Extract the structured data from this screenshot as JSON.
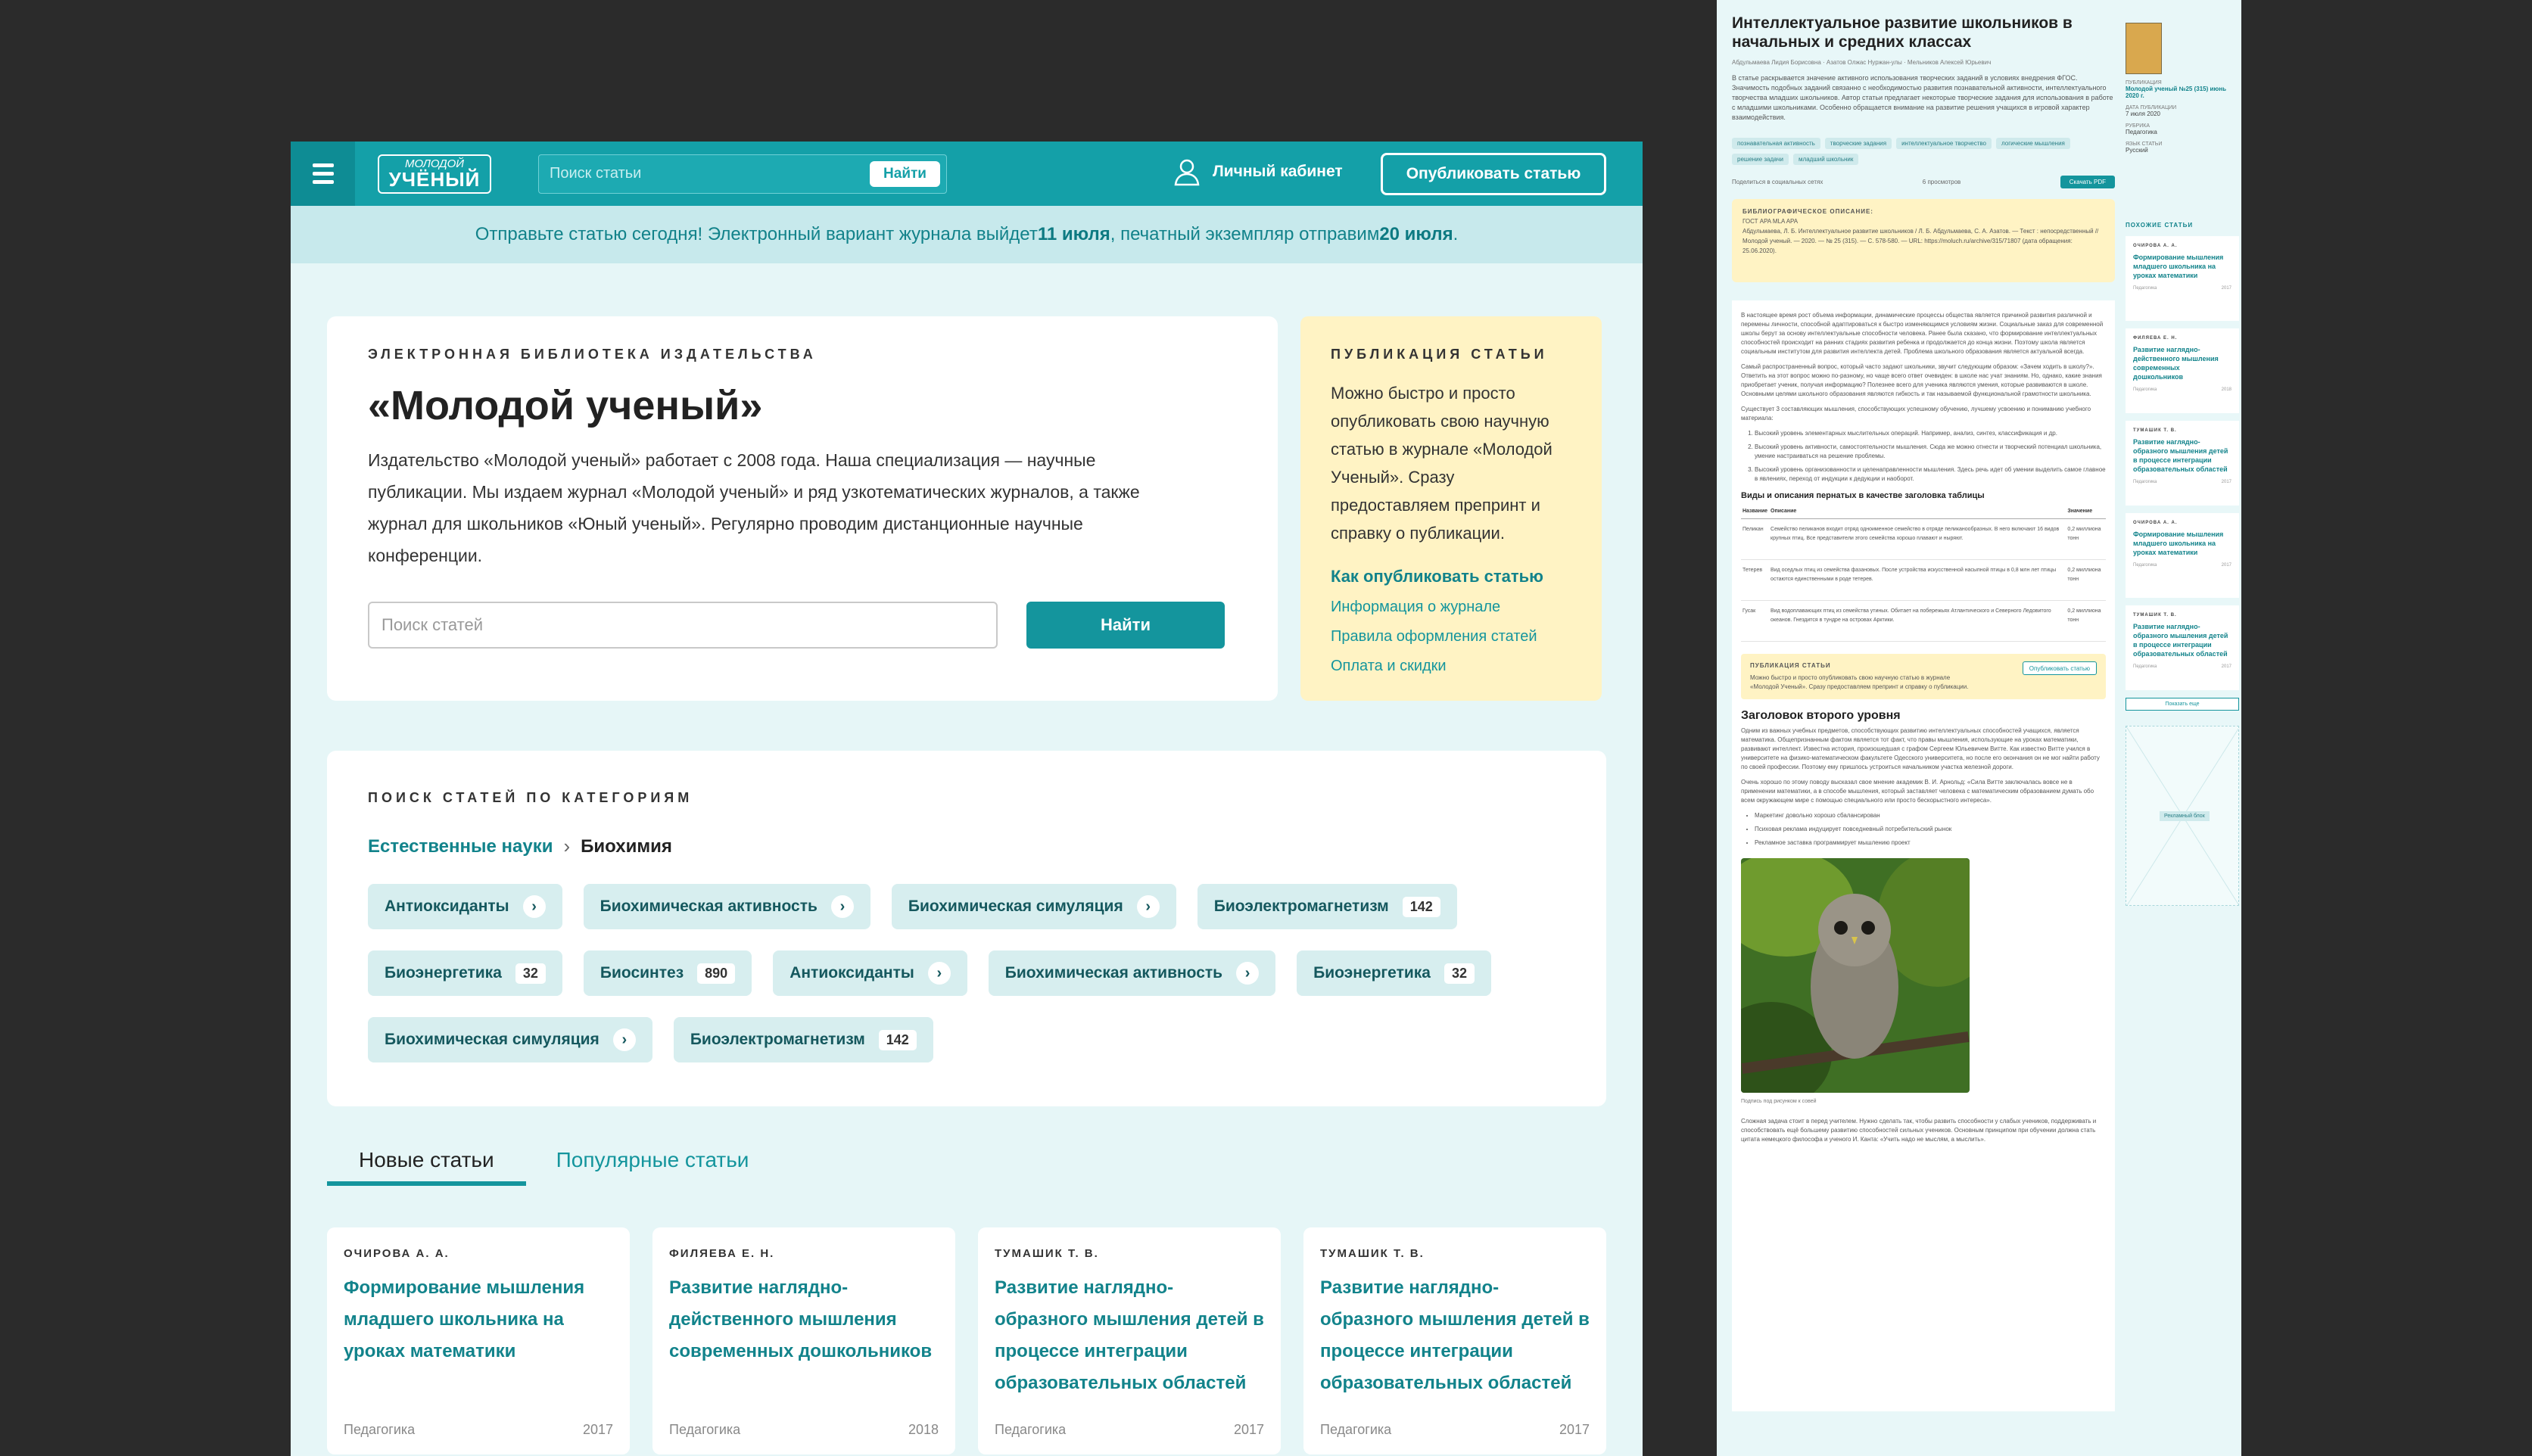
{
  "home": {
    "header": {
      "logo_line1": "МОЛОДОЙ",
      "logo_line2": "УЧЁНЫЙ",
      "search_placeholder": "Поиск статьи",
      "search_button": "Найти",
      "cabinet": "Личный кабинет",
      "publish_button": "Опубликовать статью"
    },
    "notice": {
      "part1": "Отправьте статью сегодня! Электронный вариант журнала выйдет ",
      "date1": "11 июля",
      "part2": ", печатный экземпляр отправим ",
      "date2": "20 июля",
      "part3": "."
    },
    "intro": {
      "kicker": "Электронная библиотека издательства",
      "title": "«Молодой ученый»",
      "text": "Издательство «Молодой ученый» работает с 2008 года. Наша специализация — научные публикации. Мы издаем журнал «Молодой ученый» и ряд узкотематических журналов, а также журнал для школьников «Юный ученый». Регулярно проводим дистанционные научные конференции.",
      "search_placeholder": "Поиск статей",
      "search_button": "Найти"
    },
    "publication": {
      "kicker": "Публикация статьи",
      "text": "Можно быстро и просто опубликовать свою научную статью в журнале «Молодой Ученый». Сразу предоставляем препринт и справку о публикации.",
      "how": "Как опубликовать статью",
      "links": [
        "Информация о журнале",
        "Правила оформления статей",
        "Оплата и скидки"
      ]
    },
    "categories": {
      "kicker": "Поиск статей по категориям",
      "crumb1": "Естественные науки",
      "crumb2": "Биохимия",
      "tags": [
        {
          "label": "Антиоксиданты",
          "count": null
        },
        {
          "label": "Биохимическая активность",
          "count": null
        },
        {
          "label": "Биохимическая симуляция",
          "count": null
        },
        {
          "label": "Биоэлектромагнетизм",
          "count": "142"
        },
        {
          "label": "Биоэнергетика",
          "count": "32"
        },
        {
          "label": "Биосинтез",
          "count": "890"
        },
        {
          "label": "Антиоксиданты",
          "count": null
        },
        {
          "label": "Биохимическая активность",
          "count": null
        },
        {
          "label": "Биоэнергетика",
          "count": "32"
        },
        {
          "label": "Биохимическая симуляция",
          "count": null
        },
        {
          "label": "Биоэлектромагнетизм",
          "count": "142"
        }
      ]
    },
    "tabs": [
      "Новые статьи",
      "Популярные статьи"
    ],
    "articles": [
      {
        "author": "ОЧИРОВА А. А.",
        "title": "Формирование мышления младшего школьника на уроках математики",
        "category": "Педагогика",
        "year": "2017"
      },
      {
        "author": "ФИЛЯЕВА Е. Н.",
        "title": "Развитие наглядно-действенного мышления современных дошкольников",
        "category": "Педагогика",
        "year": "2018"
      },
      {
        "author": "ТУМАШИК Т. В.",
        "title": "Развитие наглядно-образного мышления детей в процессе интеграции образовательных областей",
        "category": "Педагогика",
        "year": "2017"
      },
      {
        "author": "ТУМАШИК Т. В.",
        "title": "Развитие наглядно-образного мышления детей в процессе интеграции образовательных областей",
        "category": "Педагогика",
        "year": "2017"
      }
    ]
  },
  "article": {
    "title": "Интеллектуальное развитие школьников в начальных и средних классах",
    "meta": "Абдульмаева Лидия Борисовна  ·  Азатов Олжас Нуржан-улы  ·  Мельников Алексей Юрьевич",
    "abstract": "В статье раскрывается значение активного использования творческих заданий в условиях внедрения ФГОС. Значимость подобных заданий связанно с необходимостью развития познавательной активности, интеллектуального творчества младших школьников. Автор статьи предлагает некоторые творческие задания для использования в работе с младшими школьниками. Особенно обращается внимание на развитие решения учащихся в игровой характер взаимодействия.",
    "keywords": [
      "познавательная активность",
      "творческие задания",
      "интеллектуальное творчество",
      "логические мышления",
      "решение задачи",
      "младший школьник"
    ],
    "share": "Поделиться в социальных сетях",
    "views": "6 просмотров",
    "pdf": "Скачать PDF",
    "cite_title": "БИБЛИОГРАФИЧЕСКОЕ ОПИСАНИЕ:",
    "cite_formats": "ГОСТ     APA     MLA     APA",
    "cite": "Абдульмаева, Л. Б. Интеллектуальное развитие школьников / Л. Б. Абдульмаева, С. А. Азатов. — Текст : непосредственный // Молодой ученый. — 2020. — № 25 (315). — С. 578-580. — URL: https://moluch.ru/archive/315/71807 (дата обращения: 25.06.2020).",
    "p1": "В настоящее время рост объема информации, динамические процессы общества является причиной развития различной и перемены личности, способной адаптироваться к быстро изменяющимся условиям жизни. Социальные заказ для современной школы берут за основу интеллектуальные способности человека. Ранее была сказано, что формирование интеллектуальных способностей происходит на ранних стадиях развития ребенка и продолжается до конца жизни. Поэтому школа является социальным институтом для развития интеллекта детей. Проблема школьного образования является актуальной всегда.",
    "p2": "Самый распространенный вопрос, который часто задают школьники, звучит следующим образом: «Зачем ходить в школу?». Ответить на этот вопрос можно по-разному, но чаще всего ответ очевиден: в школе нас учат знаниям. Но, однако, какие знания приобретает ученик, получая информацию? Полезнее всего для ученика являются умения, которые развиваются в школе. Основными целями школьного образования являются гибкость и так называемой функциональной грамотности школьника.",
    "p3": "Существует 3 составляющих мышления, способствующих успешному обучению, лучшему усвоению и пониманию учебного материала:",
    "list": [
      "Высокий уровень элементарных мыслительных операций. Например, анализ, синтез, классификация и др.",
      "Высокий уровень активности, самостоятельности мышления. Сюда же можно отнести и творческий потенциал школьника, умение настраиваться на решение проблемы.",
      "Высокий уровень организованности и целенаправленности мышления. Здесь речь идет об умении выделить самое главное в явлениях, переход от индукции к дедукции и наоборот."
    ],
    "table_title": "Виды и описания пернатых в качестве заголовка таблицы",
    "table_head": [
      "Название",
      "Описание",
      "Значение"
    ],
    "table_rows": [
      [
        "Пеликан",
        "Семейство пеликанов входит отряд одноименное семейство в отряде пеликанообразных. В него включают 16 видов крупных птиц. Все представители этого семейства хорошо плавают и ныряют.",
        "0,2 миллиона тонн"
      ],
      [
        "Тетерев",
        "Вид оседлых птиц из семейства фазановых. После устройства искусственной насыпной птицы в 0,8 млн лет птицы остаются единственными в роде тетерев.",
        "0,2 миллиона тонн"
      ],
      [
        "Гусак",
        "Вид водоплавающих птиц из семейства утиных. Обитает на побережьях Атлантического и Северного Ледовитого океанов. Гнездится в тундре на островах Арктики.",
        "0,2 миллиона тонн"
      ]
    ],
    "promo_kicker": "ПУБЛИКАЦИЯ СТАТЬИ",
    "promo_text": "Можно быстро и просто опубликовать свою научную статью в журнале «Молодой Ученый». Сразу предоставляем препринт и справку о публикации.",
    "promo_button": "Опубликовать статью",
    "h2": "Заголовок второго уровня",
    "p4": "Одним из важных учебных предметов, способствующих развитию интеллектуальных способностей учащихся, является математика. Общепризнанным фактом является тот факт, что правы мышления, использующие на уроках математики, развивают интеллект. Известна история, произошедшая с графом Сергеем Юльевичем Витте. Как известно Витте учился в университете на физико-математическом факультете Одесского университета, но после его окончания он не мог найти работу по своей профессии. Поэтому ему пришлось устроиться начальником участка железной дороги.",
    "p5": "Очень хорошо по этому поводу высказал свое мнение академик В. И. Арнольд: «Сила Витте заключалась вовсе не в применении математики, а в способе мышления, который заставляет человека с математическим образованием думать обо всем окружающем мире с помощью специального или просто бескорыстного интереса».",
    "bullets": [
      "Маркетинг довольно хорошо сбалансирован",
      "Психовая реклама индуцирует повседневный потребительский рынок",
      "Рекламное заставка программирует мышлению проект"
    ],
    "caption": "Подпись под рисунком к совей",
    "p6": "Сложная задача стоит в перед учителем. Нужно сделать так, чтобы развить способности у слабых учеников, поддерживать и способствовать ещё большему развитию способностей сильных учеников. Основным принципом при обучении должна стать цитата немецкого философа и ученого И. Канта: «Учить надо не мыслям, а мыслить».",
    "aside": {
      "label1": "ПУБЛИКАЦИЯ",
      "journal": "Молодой ученый №25 (315) июнь 2020 г.",
      "label2": "ДАТА ПУБЛИКАЦИИ",
      "date": "7 июля 2020",
      "label3": "РУБРИКА",
      "rubric": "Педагогика",
      "label4": "ЯЗЫК СТАТЬИ",
      "lang": "Русский",
      "similar": "ПОХОЖИЕ СТАТЬИ",
      "similar_items": [
        {
          "author": "ОЧИРОВА А. А.",
          "title": "Формирование мышления младшего школьника на уроках математики",
          "cat": "Педагогика",
          "year": "2017"
        },
        {
          "author": "ФИЛЯЕВА Е. Н.",
          "title": "Развитие наглядно-действенного мышления современных дошкольников",
          "cat": "Педагогика",
          "year": "2018"
        },
        {
          "author": "ТУМАШИК Т. В.",
          "title": "Развитие наглядно-образного мышления детей в процессе интеграции образовательных областей",
          "cat": "Педагогика",
          "year": "2017"
        },
        {
          "author": "ОЧИРОВА А. А.",
          "title": "Формирование мышления младшего школьника на уроках математики",
          "cat": "Педагогика",
          "year": "2017"
        },
        {
          "author": "ТУМАШИК Т. В.",
          "title": "Развитие наглядно-образного мышления детей в процессе интеграции образовательных областей",
          "cat": "Педагогика",
          "year": "2017"
        }
      ],
      "show_more": "Показать еще",
      "ad": "Рекламный блок"
    }
  }
}
